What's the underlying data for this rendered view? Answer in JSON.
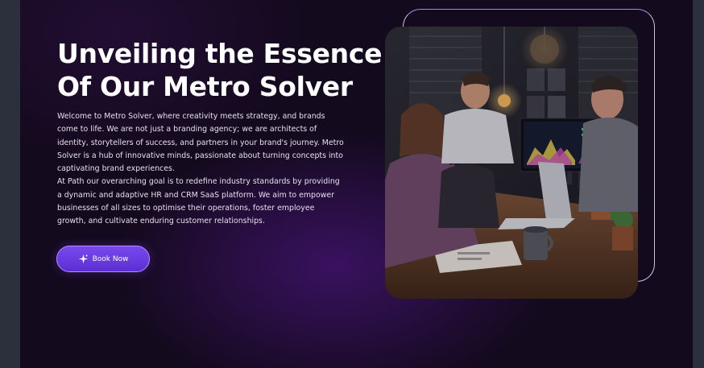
{
  "hero": {
    "title_line1": "Unveiling the Essence",
    "title_line2": "Of Our Metro Solver",
    "paragraph1": "Welcome to Metro Solver, where creativity meets strategy, and brands come to life. We are not just a branding agency; we are architects of identity, storytellers of success, and partners in your brand's journey. Metro Solver is a hub of innovative minds, passionate about turning concepts into captivating brand experiences.",
    "paragraph2": "At Path our overarching goal is to redefine industry standards by providing a dynamic and adaptive HR and CRM SaaS platform. We aim to empower businesses of all sizes to optimise their operations, foster employee growth, and cultivate enduring customer relationships.",
    "button_label": "Book Now",
    "button_icon": "sparkle-icon"
  },
  "colors": {
    "page_bg": "#140a1e",
    "accent": "#6a3ae6",
    "side_panel": "#2b303c"
  }
}
